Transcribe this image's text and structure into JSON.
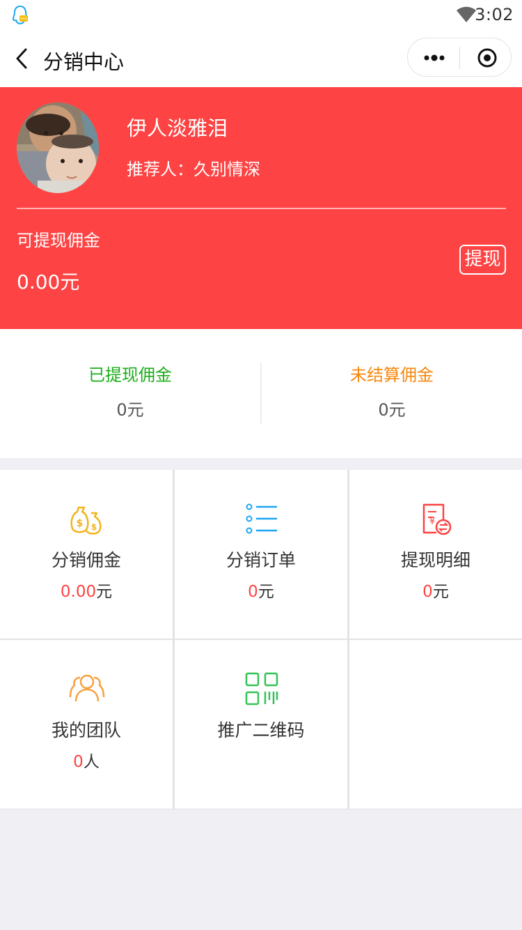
{
  "status_bar": {
    "time": "3:02"
  },
  "nav": {
    "title": "分销中心"
  },
  "profile": {
    "username": "伊人淡雅泪",
    "referrer": "推荐人：久别情深"
  },
  "balance": {
    "label": "可提现佣金",
    "value": "0.00元",
    "withdraw_button": "提现"
  },
  "summary": {
    "withdrawn_label": "已提现佣金",
    "withdrawn_value": "0元",
    "unsettled_label": "未结算佣金",
    "unsettled_value": "0元"
  },
  "menu": [
    {
      "label": "分销佣金",
      "num": "0.00",
      "unit": "元",
      "icon": "money-bags-icon"
    },
    {
      "label": "分销订单",
      "num": "0",
      "unit": "元",
      "icon": "list-icon"
    },
    {
      "label": "提现明细",
      "num": "0",
      "unit": "元",
      "icon": "withdraw-detail-icon"
    },
    {
      "label": "我的团队",
      "num": "0",
      "unit": "人",
      "icon": "team-icon"
    },
    {
      "label": "推广二维码",
      "icon": "qr-code-icon"
    }
  ],
  "colors": {
    "brand_red": "#fd4343",
    "green": "#1aad19",
    "orange": "#f7870b",
    "blue": "#1aa6f2",
    "qr_green": "#34c255",
    "icon_orange": "#f9a03f",
    "icon_yellow": "#f3b21c"
  }
}
